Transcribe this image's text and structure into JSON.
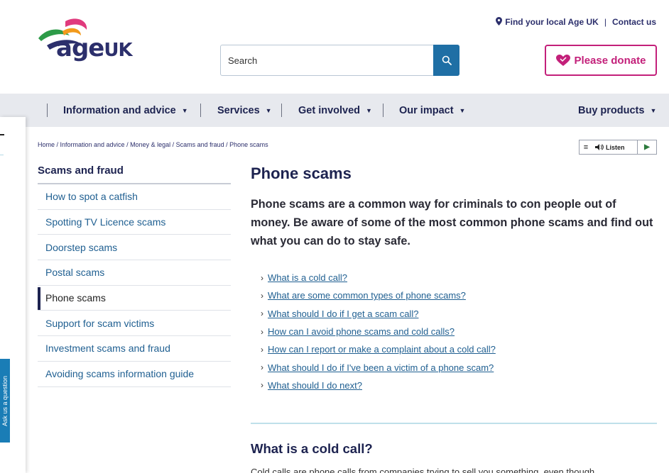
{
  "brand": {
    "logo_main": "age",
    "logo_suffix": "UK"
  },
  "top_links": {
    "find_local": "Find your local Age UK",
    "contact": "Contact us"
  },
  "search": {
    "placeholder": "Search"
  },
  "donate": {
    "label": "Please donate"
  },
  "nav": {
    "items": [
      {
        "label": "Information and advice"
      },
      {
        "label": "Services"
      },
      {
        "label": "Get involved"
      },
      {
        "label": "Our impact"
      },
      {
        "label": "Buy products"
      }
    ]
  },
  "left_panel": {
    "ask_tab": "Ask us a question"
  },
  "breadcrumb": "Home / Information and advice / Money & legal / Scams and fraud / Phone scams",
  "listen": {
    "label": "Listen"
  },
  "sidebar": {
    "title": "Scams and fraud",
    "items": [
      {
        "label": "How to spot a catfish"
      },
      {
        "label": "Spotting TV Licence scams"
      },
      {
        "label": "Doorstep scams"
      },
      {
        "label": "Postal scams"
      },
      {
        "label": "Phone scams"
      },
      {
        "label": "Support for scam victims"
      },
      {
        "label": "Investment scams and fraud"
      },
      {
        "label": "Avoiding scams information guide"
      }
    ],
    "active_index": 4
  },
  "main": {
    "title": "Phone scams",
    "intro": "Phone scams are a common way for criminals to con people out of money. Be aware of some of the most common phone scams and find out what you can do to stay safe.",
    "toc": [
      {
        "label": "What is a cold call?"
      },
      {
        "label": "What are some common types of phone scams?"
      },
      {
        "label": "What should I do if I get a scam call?"
      },
      {
        "label": "How can I avoid phone scams and cold calls?"
      },
      {
        "label": "How can I report or make a complaint about a cold call?"
      },
      {
        "label": "What should I do if I've been a victim of a phone scam?"
      },
      {
        "label": "What should I do next?"
      }
    ],
    "section_heading": "What is a cold call?",
    "section_text": "Cold calls are phone calls from companies trying to sell you something, even though"
  },
  "colors": {
    "brand_navy": "#1d2350",
    "link_blue": "#1f5f91",
    "donate_pink": "#c3207a",
    "search_button": "#1f6fa5",
    "nav_bg": "#e7e9ee",
    "divider": "#bfe0ea"
  }
}
